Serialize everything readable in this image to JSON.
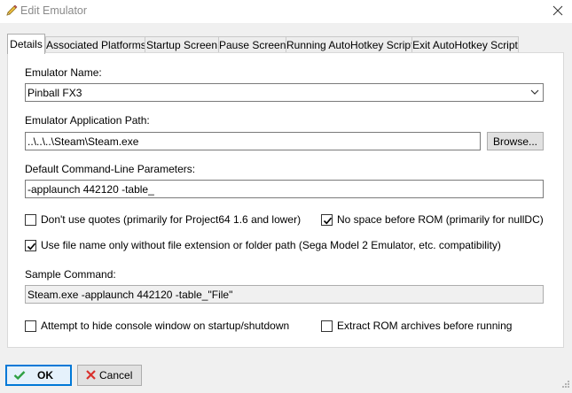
{
  "window": {
    "title": "Edit Emulator",
    "title_icon": "pencil-icon",
    "close_icon": "close-icon"
  },
  "tabs": [
    {
      "label": "Details",
      "active": true
    },
    {
      "label": "Associated Platforms"
    },
    {
      "label": "Startup Screen"
    },
    {
      "label": "Pause Screen"
    },
    {
      "label": "Running AutoHotkey Script"
    },
    {
      "label": "Exit AutoHotkey Script"
    }
  ],
  "details": {
    "emulator_name_label": "Emulator Name:",
    "emulator_name_value": "Pinball FX3",
    "app_path_label": "Emulator Application Path:",
    "app_path_value": "..\\..\\..\\Steam\\Steam.exe",
    "browse_label": "Browse...",
    "cmdline_label": "Default Command-Line Parameters:",
    "cmdline_value": "-applaunch 442120 -table_",
    "no_quotes": {
      "label": "Don't use quotes (primarily for Project64 1.6 and lower)",
      "checked": false
    },
    "no_space": {
      "label": "No space before ROM (primarily for nullDC)",
      "checked": true
    },
    "filename_only": {
      "label": "Use file name only without file extension or folder path (Sega Model 2 Emulator, etc. compatibility)",
      "checked": true
    },
    "sample_label": "Sample Command:",
    "sample_value": "Steam.exe -applaunch 442120 -table_\"File\"",
    "hide_console": {
      "label": "Attempt to hide console window on startup/shutdown",
      "checked": false
    },
    "extract_rom": {
      "label": "Extract ROM archives before running",
      "checked": false
    }
  },
  "footer": {
    "ok_label": "OK",
    "ok_icon": "checkmark-icon",
    "cancel_label": "Cancel",
    "cancel_icon": "red-x-icon"
  },
  "colors": {
    "accent": "#0078d7",
    "ok_green": "#2ea043",
    "cancel_red": "#d9302c"
  }
}
